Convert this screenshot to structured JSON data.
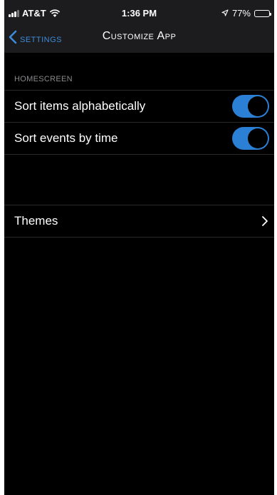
{
  "status_bar": {
    "carrier": "AT&T",
    "time": "1:36 PM",
    "battery": "77%",
    "battery_level": 0.77,
    "icons": [
      "signal-icon",
      "wifi-icon",
      "location-icon",
      "battery-icon"
    ]
  },
  "nav": {
    "back_label": "Settings",
    "title": "Customize App"
  },
  "homescreen": {
    "header": "HOMESCREEN",
    "items": [
      {
        "label": "Sort items alphabetically",
        "enabled": true
      },
      {
        "label": "Sort events by time",
        "enabled": true
      }
    ]
  },
  "themes": {
    "label": "Themes"
  },
  "colors": {
    "accent": "#3d8bd9",
    "toggle_on": "#2b7fd4",
    "background": "#000000",
    "bar": "#1c1c1e"
  }
}
